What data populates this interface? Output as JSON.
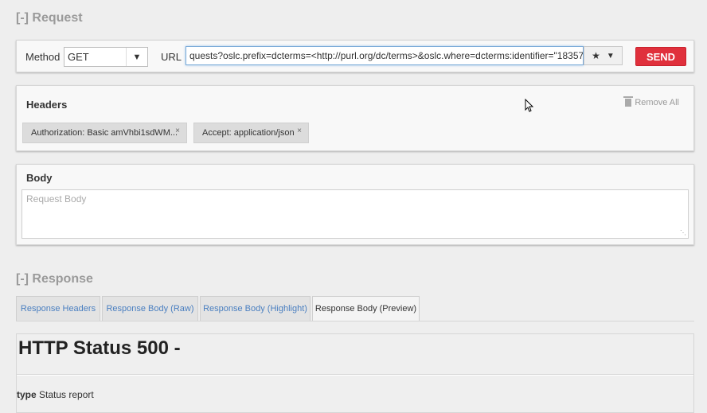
{
  "request": {
    "section_title": "[-] Request",
    "method_label": "Method",
    "method_value": "GET",
    "url_label": "URL",
    "url_value": "quests?oslc.prefix=dcterms=<http://purl.org/dc/terms>&oslc.where=dcterms:identifier=\"18357\"",
    "send_label": "SEND"
  },
  "headers": {
    "title": "Headers",
    "remove_all": "Remove All",
    "items": [
      {
        "label": "Authorization: Basic amVhbi1sdWM..."
      },
      {
        "label": "Accept: application/json"
      }
    ]
  },
  "body": {
    "title": "Body",
    "placeholder": "Request Body"
  },
  "response": {
    "section_title": "[-] Response",
    "tabs": [
      {
        "label": "Response Headers"
      },
      {
        "label": "Response Body (Raw)"
      },
      {
        "label": "Response Body (Highlight)"
      },
      {
        "label": "Response Body (Preview)"
      }
    ],
    "preview_heading": "HTTP Status 500 -",
    "type_label": "type",
    "type_value": "Status report"
  }
}
